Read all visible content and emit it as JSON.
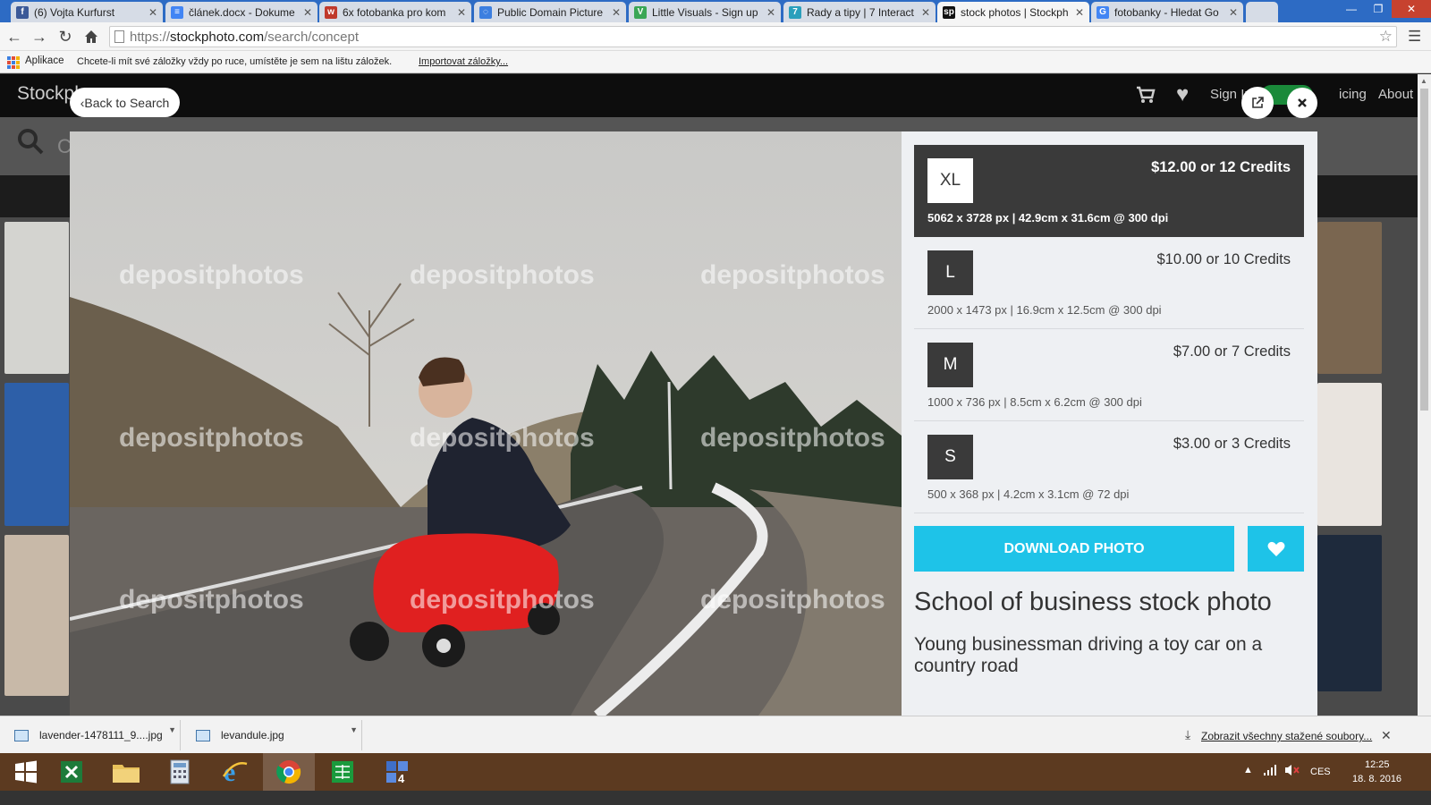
{
  "browser": {
    "tabs": [
      {
        "title": "(6) Vojta Kurfurst",
        "icon": "facebook-icon",
        "color": "#3b5998",
        "glyph": "f"
      },
      {
        "title": "článek.docx - Dokume",
        "icon": "docs-icon",
        "color": "#4285f4",
        "glyph": "≡"
      },
      {
        "title": "6x fotobanka pro kom",
        "icon": "w-site-icon",
        "color": "#c0392b",
        "glyph": "w"
      },
      {
        "title": "Public Domain Picture",
        "icon": "loading-icon",
        "color": "#3c7fe0",
        "glyph": "◌"
      },
      {
        "title": "Little Visuals - Sign up",
        "icon": "littlevisuals-icon",
        "color": "#3aa655",
        "glyph": "V"
      },
      {
        "title": "Rady a tipy | 7 Interact",
        "icon": "seven-icon",
        "color": "#2a9fbc",
        "glyph": "7"
      },
      {
        "title": "stock photos | Stockph",
        "icon": "stockphoto-icon",
        "color": "#111111",
        "glyph": "sp"
      },
      {
        "title": "fotobanky - Hledat Go",
        "icon": "google-icon",
        "color": "#4285f4",
        "glyph": "G"
      }
    ],
    "active_tab": 6,
    "url_scheme": "https://",
    "url_host": "stockphoto.com",
    "url_path": "/search/concept",
    "bookmarks": {
      "apps_label": "Aplikace",
      "hint": "Chcete-li mít své záložky vždy po ruce, umístěte je sem na lištu záložek.",
      "import_link": "Importovat záložky..."
    }
  },
  "site": {
    "logo": "Stockph",
    "signin": "Sign In",
    "pricing": "icing",
    "about": "About",
    "search_placeholder": "C"
  },
  "modal": {
    "back_label": "Back to Search",
    "watermark": "depositphotos",
    "options": [
      {
        "size": "XL",
        "price": "$12.00 or 12 Credits",
        "dims": "5062 x 3728 px | 42.9cm x 31.6cm @ 300 dpi",
        "selected": true
      },
      {
        "size": "L",
        "price": "$10.00 or 10 Credits",
        "dims": "2000 x 1473 px | 16.9cm x 12.5cm @ 300 dpi",
        "selected": false
      },
      {
        "size": "M",
        "price": "$7.00 or 7 Credits",
        "dims": "1000 x 736 px | 8.5cm x 6.2cm @ 300 dpi",
        "selected": false
      },
      {
        "size": "S",
        "price": "$3.00 or 3 Credits",
        "dims": "500 x 368 px | 4.2cm x 3.1cm @ 72 dpi",
        "selected": false
      }
    ],
    "download_label": "DOWNLOAD PHOTO",
    "title": "School of business stock photo",
    "description": "Young businessman driving a toy car on a country road",
    "accent_color": "#1ec3e8"
  },
  "downloads": {
    "items": [
      {
        "name": "lavender-1478111_9....jpg"
      },
      {
        "name": "levandule.jpg"
      }
    ],
    "show_all": "Zobrazit všechny stažené soubory..."
  },
  "taskbar": {
    "apps": [
      "windows-start-icon",
      "excel-icon",
      "file-explorer-icon",
      "calculator-icon",
      "internet-explorer-icon",
      "chrome-icon",
      "spreadsheet-icon",
      "app-4-icon"
    ],
    "lang": "CES",
    "time": "12:25",
    "date": "18. 8. 2016"
  }
}
